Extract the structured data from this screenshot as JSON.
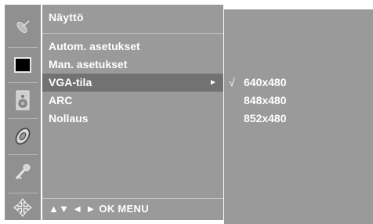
{
  "menu": {
    "title": "Näyttö",
    "items": [
      {
        "label": "Autom. asetukset"
      },
      {
        "label": "Man. asetukset"
      },
      {
        "label": "VGA-tila",
        "arrow": "►"
      },
      {
        "label": "ARC"
      },
      {
        "label": "Nollaus"
      }
    ],
    "selected_index": 2,
    "footer": "▲▼ ◄ ► OK MENU"
  },
  "submenu": {
    "check_mark": "√",
    "options": [
      "640x480",
      "848x480",
      "852x480"
    ],
    "checked_index": 0
  },
  "icons": [
    "satellite-dish-icon",
    "screen-icon",
    "speaker-icon",
    "disc-icon",
    "key-icon",
    "move-arrows-icon"
  ],
  "colors": {
    "panel": "#9a9a9a",
    "selected_row": "#727272",
    "icon_column": "#909090",
    "text": "#ffffff"
  }
}
